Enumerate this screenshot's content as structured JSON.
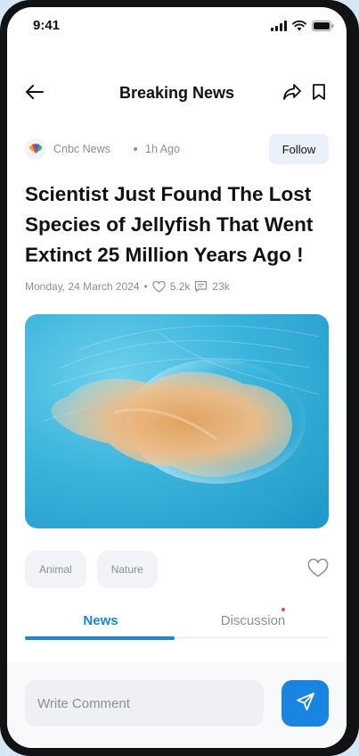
{
  "status": {
    "time": "9:41",
    "icons": [
      "signal-icon",
      "wifi-icon",
      "battery-icon"
    ]
  },
  "header": {
    "title": "Breaking News",
    "icons": [
      "back-arrow-icon",
      "share-icon",
      "bookmark-icon"
    ]
  },
  "source": {
    "name": "Cnbc News",
    "time": "1h Ago",
    "follow_label": "Follow",
    "logo_icon": "nbc-peacock-logo"
  },
  "article": {
    "headline": "Scientist Just Found The Lost Species of Jellyfish That Went Extinct 25 Million Years Ago !",
    "date": "Monday, 24 March 2024",
    "likes": "5.2k",
    "comments": "23k"
  },
  "tags": [
    "Animal",
    "Nature"
  ],
  "tabs": {
    "news": "News",
    "discussion": "Discussion"
  },
  "comment": {
    "placeholder": "Write Comment"
  },
  "colors": {
    "accent": "#1a85e0",
    "tag_bg": "#f1f3f6",
    "follow_bg": "#eaf1fb",
    "notification_dot": "#f0464b"
  }
}
